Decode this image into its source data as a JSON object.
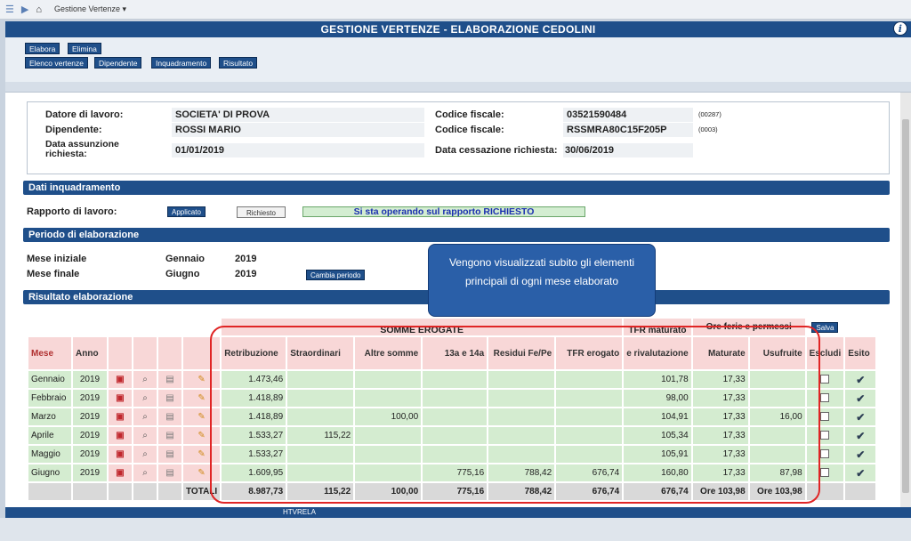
{
  "topbar": {
    "menu": "Gestione Vertenze ▾"
  },
  "title": "GESTIONE VERTENZE - ELABORAZIONE CEDOLINI",
  "toolbar": {
    "elabora": "Elabora",
    "elimina": "Elimina",
    "elenco": "Elenco vertenze",
    "dipendente": "Dipendente",
    "inquadramento": "Inquadramento",
    "risultato": "Risultato"
  },
  "header": {
    "datore_label": "Datore di lavoro:",
    "datore_value": "SOCIETA' DI PROVA",
    "dipendente_label": "Dipendente:",
    "dipendente_value": "ROSSI MARIO",
    "assunzione_label": "Data assunzione richiesta:",
    "assunzione_value": "01/01/2019",
    "cf1_label": "Codice fiscale:",
    "cf1_value": "03521590484",
    "cf1_code": "(00287)",
    "cf2_label": "Codice fiscale:",
    "cf2_value": "RSSMRA80C15F205P",
    "cf2_code": "(0003)",
    "cessazione_label": "Data cessazione richiesta:",
    "cessazione_value": "30/06/2019"
  },
  "inquadramento": {
    "section": "Dati inquadramento",
    "rapporto_label": "Rapporto di lavoro:",
    "applicato": "Applicato",
    "richiesto": "Richiesto",
    "message": "Si sta operando sul rapporto RICHIESTO"
  },
  "periodo": {
    "section": "Periodo di elaborazione",
    "iniziale_label": "Mese iniziale",
    "iniziale_mese": "Gennaio",
    "iniziale_anno": "2019",
    "finale_label": "Mese finale",
    "finale_mese": "Giugno",
    "finale_anno": "2019",
    "cambia": "Cambia periodo"
  },
  "tooltip": "Vengono visualizzati subito gli elementi principali di ogni mese elaborato",
  "risultato": {
    "section": "Risultato elaborazione",
    "group_somme": "SOMME EROGATE",
    "group_tfr": "TFR maturato",
    "group_ore": "Ore ferie e permessi",
    "salva": "Salva",
    "headers": {
      "mese": "Mese",
      "anno": "Anno",
      "retribuzione": "Retribuzione",
      "straordinari": "Straordinari",
      "altre": "Altre somme",
      "tredicesima": "13a e 14a",
      "residui": "Residui Fe/Pe",
      "tfr_erogato": "TFR erogato",
      "rivalutazione": "e rivalutazione",
      "maturate": "Maturate",
      "usufruite": "Usufruite",
      "escludi": "Escludi",
      "esito": "Esito"
    },
    "rows": [
      {
        "mese": "Gennaio",
        "anno": "2019",
        "retr": "1.473,46",
        "straord": "",
        "altre": "",
        "tred": "",
        "resid": "",
        "tfrer": "",
        "tfrmat": "101,78",
        "mat": "17,33",
        "usuf": ""
      },
      {
        "mese": "Febbraio",
        "anno": "2019",
        "retr": "1.418,89",
        "straord": "",
        "altre": "",
        "tred": "",
        "resid": "",
        "tfrer": "",
        "tfrmat": "98,00",
        "mat": "17,33",
        "usuf": ""
      },
      {
        "mese": "Marzo",
        "anno": "2019",
        "retr": "1.418,89",
        "straord": "",
        "altre": "100,00",
        "tred": "",
        "resid": "",
        "tfrer": "",
        "tfrmat": "104,91",
        "mat": "17,33",
        "usuf": "16,00"
      },
      {
        "mese": "Aprile",
        "anno": "2019",
        "retr": "1.533,27",
        "straord": "115,22",
        "altre": "",
        "tred": "",
        "resid": "",
        "tfrer": "",
        "tfrmat": "105,34",
        "mat": "17,33",
        "usuf": ""
      },
      {
        "mese": "Maggio",
        "anno": "2019",
        "retr": "1.533,27",
        "straord": "",
        "altre": "",
        "tred": "",
        "resid": "",
        "tfrer": "",
        "tfrmat": "105,91",
        "mat": "17,33",
        "usuf": ""
      },
      {
        "mese": "Giugno",
        "anno": "2019",
        "retr": "1.609,95",
        "straord": "",
        "altre": "",
        "tred": "775,16",
        "resid": "788,42",
        "tfrer": "676,74",
        "tfrmat": "160,80",
        "mat": "17,33",
        "usuf": "87,98"
      }
    ],
    "totals": {
      "label": "TOTALI",
      "retr": "8.987,73",
      "straord": "115,22",
      "altre": "100,00",
      "tred": "775,16",
      "resid": "788,42",
      "tfrer": "676,74",
      "tfrmat": "676,74",
      "mat": "Ore 103,98",
      "usuf": "Ore 103,98"
    }
  },
  "footer": "HTVRELA"
}
